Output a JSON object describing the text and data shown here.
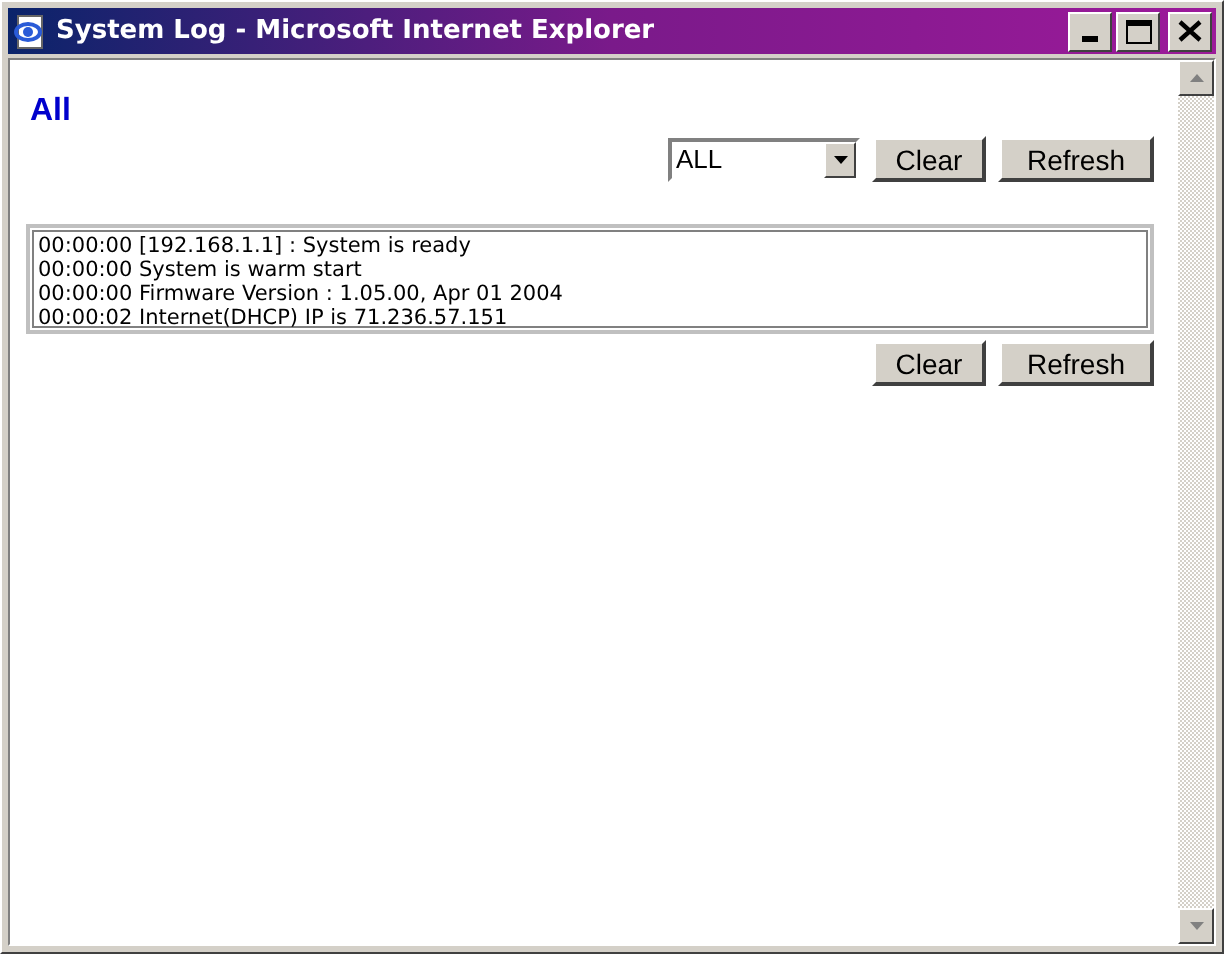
{
  "window": {
    "title": "System Log - Microsoft Internet Explorer"
  },
  "heading": "All",
  "filter": {
    "value": "ALL"
  },
  "top_buttons": [
    "Clear",
    "Refresh"
  ],
  "log_lines": [
    "00:00:00 [192.168.1.1] : System is ready",
    "00:00:00 System is warm start",
    "00:00:00 Firmware Version : 1.05.00, Apr 01 2004",
    "00:00:02 Internet(DHCP) IP is 71.236.57.151"
  ],
  "bottom_buttons": [
    "Clear",
    "Refresh"
  ]
}
